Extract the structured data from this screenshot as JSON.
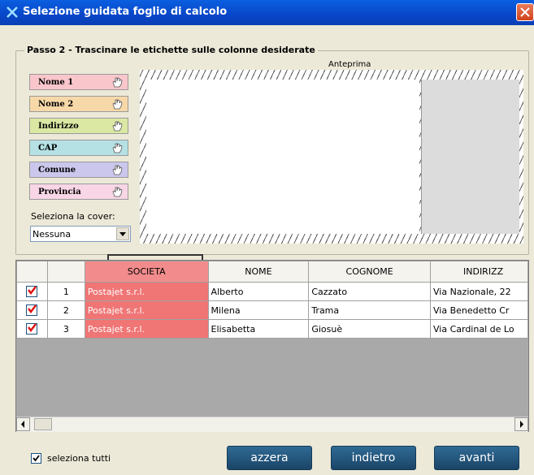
{
  "window": {
    "title": "Selezione guidata foglio di calcolo"
  },
  "step": {
    "title": "Passo 2 - Trascinare le etichette sulle colonne desiderate"
  },
  "labels": [
    {
      "text": "Nome 1",
      "color": "#f9c6cc"
    },
    {
      "text": "Nome 2",
      "color": "#f7d8a8"
    },
    {
      "text": "Indirizzo",
      "color": "#dbe8a4"
    },
    {
      "text": "CAP",
      "color": "#b5e1e4"
    },
    {
      "text": "Comune",
      "color": "#cbc7ec"
    },
    {
      "text": "Provincia",
      "color": "#f8d6e6"
    }
  ],
  "cover": {
    "label": "Seleziona la cover:",
    "value": "Nessuna"
  },
  "preview": {
    "label": "Anteprima"
  },
  "grid": {
    "columns": [
      "",
      "",
      "SOCIETA",
      "NOME",
      "COGNOME",
      "INDIRIZZ"
    ],
    "rows": [
      {
        "checked": true,
        "num": "1",
        "societa": "Postajet s.r.l.",
        "nome": "Alberto",
        "cognome": "Cazzato",
        "indirizzo": "Via Nazionale, 22"
      },
      {
        "checked": true,
        "num": "2",
        "societa": "Postajet s.r.l.",
        "nome": "Milena",
        "cognome": "Trama",
        "indirizzo": "Via Benedetto Cr"
      },
      {
        "checked": true,
        "num": "3",
        "societa": "Postajet s.r.l.",
        "nome": "Elisabetta",
        "cognome": "Giosuè",
        "indirizzo": "Via Cardinal de Lo"
      }
    ]
  },
  "select_all": {
    "label": "seleziona tutti",
    "checked": true
  },
  "buttons": {
    "reset": "azzera",
    "back": "indietro",
    "next": "avanti"
  },
  "colors": {
    "titlebar": "#0a5fe0",
    "accent_column": "#f07575",
    "button": "#1f4f75"
  }
}
